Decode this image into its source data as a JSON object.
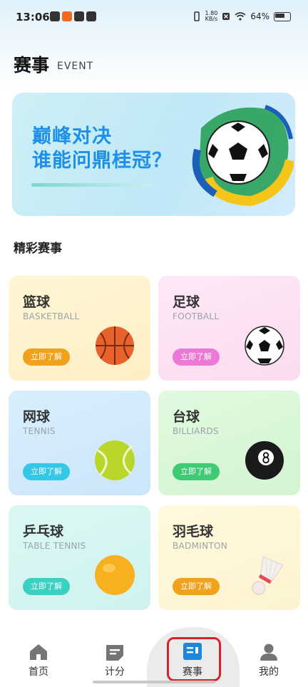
{
  "status_bar": {
    "time": "13:06",
    "net_speed_value": "1.80",
    "net_speed_unit": "KB/s",
    "battery": "64%"
  },
  "header": {
    "title": "赛事",
    "subtitle": "EVENT"
  },
  "banner": {
    "line1": "巅峰对决",
    "line2": "谁能问鼎桂冠？"
  },
  "section": {
    "title": "精彩赛事"
  },
  "cards": [
    {
      "title": "篮球",
      "en": "BASKETBALL",
      "button": "立即了解",
      "accent": "#f2a21a",
      "bg": "#fdf2cf"
    },
    {
      "title": "足球",
      "en": "FOOTBALL",
      "button": "立即了解",
      "accent": "#ec79d6",
      "bg": "#fde3f4"
    },
    {
      "title": "网球",
      "en": "TENNIS",
      "button": "立即了解",
      "accent": "#35c7e6",
      "bg": "#d5ecfb"
    },
    {
      "title": "台球",
      "en": "BILLIARDS",
      "button": "立即了解",
      "accent": "#3ecb73",
      "bg": "#dcf8dc"
    },
    {
      "title": "乒乓球",
      "en": "TABLE TENNIS",
      "button": "立即了解",
      "accent": "#39d1c1",
      "bg": "#d6f6f3"
    },
    {
      "title": "羽毛球",
      "en": "BADMINTON",
      "button": "立即了解",
      "accent": "#f2a21a",
      "bg": "#fdf6d9"
    }
  ],
  "nav": {
    "items": [
      {
        "label": "首页",
        "icon": "home-icon"
      },
      {
        "label": "计分",
        "icon": "score-icon"
      },
      {
        "label": "赛事",
        "icon": "event-icon",
        "active": true
      },
      {
        "label": "我的",
        "icon": "user-icon"
      }
    ]
  }
}
